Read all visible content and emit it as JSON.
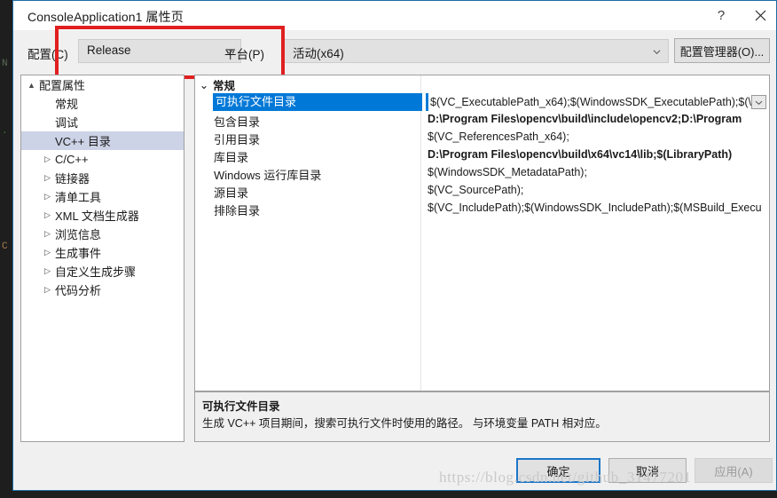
{
  "backdrop": {
    "code_lines": [
      "N",
      ".",
      "C"
    ]
  },
  "window": {
    "title": "ConsoleApplication1 属性页",
    "help_button": "?",
    "help_icon": "question-mark-icon",
    "close_icon": "close-x-icon"
  },
  "config_bar": {
    "config_label": "配置(C)",
    "config_value": "Release",
    "platform_label": "平台(P)",
    "platform_value": "活动(x64)",
    "config_manager_button": "配置管理器(O)..."
  },
  "tree": {
    "items": [
      {
        "label": "配置属性",
        "indent": 0,
        "twisty": "▲",
        "selected": false
      },
      {
        "label": "常规",
        "indent": 1,
        "twisty": "",
        "selected": false
      },
      {
        "label": "调试",
        "indent": 1,
        "twisty": "",
        "selected": false
      },
      {
        "label": "VC++ 目录",
        "indent": 1,
        "twisty": "",
        "selected": true
      },
      {
        "label": "C/C++",
        "indent": 1,
        "twisty": "▷",
        "selected": false
      },
      {
        "label": "链接器",
        "indent": 1,
        "twisty": "▷",
        "selected": false
      },
      {
        "label": "清单工具",
        "indent": 1,
        "twisty": "▷",
        "selected": false
      },
      {
        "label": "XML 文档生成器",
        "indent": 1,
        "twisty": "▷",
        "selected": false
      },
      {
        "label": "浏览信息",
        "indent": 1,
        "twisty": "▷",
        "selected": false
      },
      {
        "label": "生成事件",
        "indent": 1,
        "twisty": "▷",
        "selected": false
      },
      {
        "label": "自定义生成步骤",
        "indent": 1,
        "twisty": "▷",
        "selected": false
      },
      {
        "label": "代码分析",
        "indent": 1,
        "twisty": "▷",
        "selected": false
      }
    ]
  },
  "grid": {
    "category": "常规",
    "category_chevron": "⌄",
    "rows": [
      {
        "name": "可执行文件目录",
        "value": "$(VC_ExecutablePath_x64);$(WindowsSDK_ExecutablePath);$(\\",
        "bold": false,
        "selected": true
      },
      {
        "name": "包含目录",
        "value": "D:\\Program Files\\opencv\\build\\include\\opencv2;D:\\Program",
        "bold": true,
        "selected": false
      },
      {
        "name": "引用目录",
        "value": "$(VC_ReferencesPath_x64);",
        "bold": false,
        "selected": false
      },
      {
        "name": "库目录",
        "value": "D:\\Program Files\\opencv\\build\\x64\\vc14\\lib;$(LibraryPath)",
        "bold": true,
        "selected": false
      },
      {
        "name": "Windows 运行库目录",
        "value": "$(WindowsSDK_MetadataPath);",
        "bold": false,
        "selected": false
      },
      {
        "name": "源目录",
        "value": "$(VC_SourcePath);",
        "bold": false,
        "selected": false
      },
      {
        "name": "排除目录",
        "value": "$(VC_IncludePath);$(WindowsSDK_IncludePath);$(MSBuild_Execu",
        "bold": false,
        "selected": false
      }
    ]
  },
  "description": {
    "title": "可执行文件目录",
    "body": "生成 VC++ 项目期间，搜索可执行文件时使用的路径。  与环境变量 PATH 相对应。"
  },
  "footer": {
    "ok": "确定",
    "cancel": "取消",
    "apply": "应用(A)"
  },
  "watermark": {
    "text": "https://blog.csdn.net/github_31477201"
  },
  "colors": {
    "accent_blue": "#0078d7",
    "annotation_red": "#e02020",
    "tree_selection": "#cdd3e6",
    "dialog_bg": "#f0f0f0"
  }
}
